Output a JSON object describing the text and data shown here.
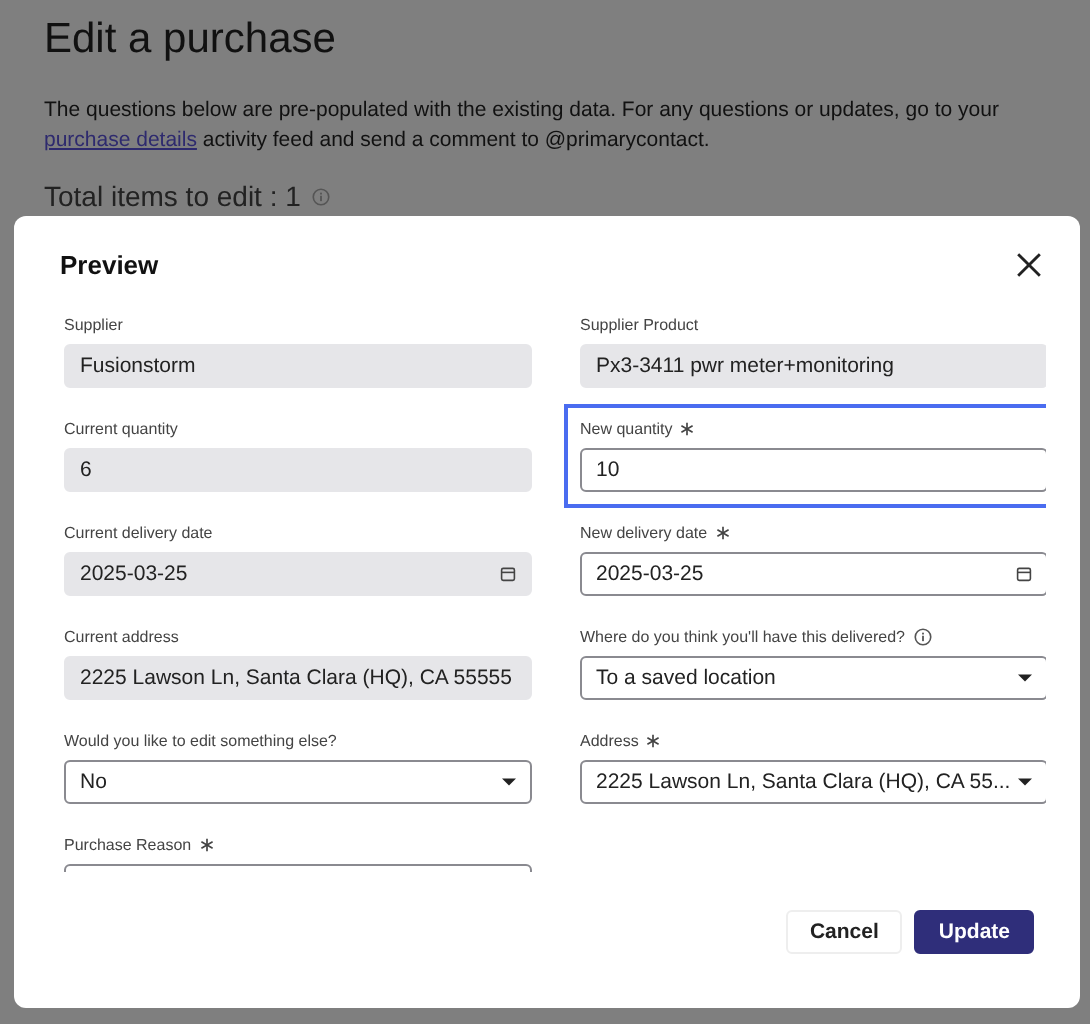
{
  "page": {
    "title": "Edit a purchase",
    "intro_before": "The questions below are pre-populated with the existing data.  For any questions or updates, go to your ",
    "intro_link": "purchase details",
    "intro_after": " activity feed and send a comment to @primarycontact.",
    "total": "Total items to edit : 1"
  },
  "dialog": {
    "title": "Preview",
    "fields": [
      {
        "label": "Supplier",
        "kind": "readonly",
        "value": "Fusionstorm",
        "required": false,
        "info": false,
        "focused": false
      },
      {
        "label": "Supplier Product",
        "kind": "readonly",
        "value": "Px3-3411 pwr meter+monitoring",
        "required": false,
        "info": false,
        "focused": false
      },
      {
        "label": "Current quantity",
        "kind": "readonly",
        "value": "6",
        "required": false,
        "info": false,
        "focused": false
      },
      {
        "label": "New quantity",
        "kind": "input",
        "value": "10",
        "required": true,
        "info": false,
        "focused": true
      },
      {
        "label": "Current delivery date",
        "kind": "readonly-date",
        "value": "2025-03-25",
        "required": false,
        "info": false,
        "focused": false
      },
      {
        "label": "New delivery date",
        "kind": "date",
        "value": "2025-03-25",
        "required": true,
        "info": false,
        "focused": false
      },
      {
        "label": "Current address",
        "kind": "readonly",
        "value": "2225 Lawson Ln, Santa Clara (HQ), CA 55555",
        "required": false,
        "info": false,
        "focused": false
      },
      {
        "label": "Where do you think you'll have this delivered?",
        "kind": "select",
        "value": "To a saved location",
        "required": false,
        "info": true,
        "focused": false
      },
      {
        "label": "Would you like to edit something else?",
        "kind": "select",
        "value": "No",
        "required": false,
        "info": false,
        "focused": false
      },
      {
        "label": "Address",
        "kind": "select",
        "value": "2225 Lawson Ln, Santa Clara (HQ), CA 55...",
        "required": true,
        "info": false,
        "focused": false
      },
      {
        "label": "Purchase Reason",
        "kind": "input",
        "required": true,
        "info": false,
        "focused": false
      }
    ],
    "buttons": [
      {
        "label": "Cancel",
        "kind": "secondary"
      },
      {
        "label": "Update",
        "kind": "primary"
      }
    ]
  }
}
